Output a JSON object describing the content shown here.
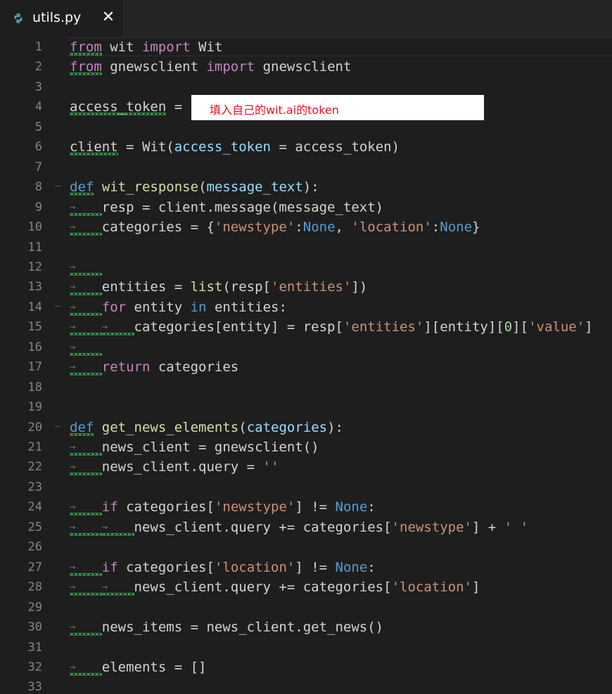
{
  "tab": {
    "label": "utils.py",
    "icon": "python-file-icon",
    "close": "✕"
  },
  "overlay": {
    "text": "填入自己的wit.ai的token"
  },
  "lines": [
    {
      "n": "1",
      "tokens": [
        [
          "k",
          "from"
        ],
        [
          "",
          ""
        ],
        [
          "",
          " wit "
        ],
        [
          "k",
          "import"
        ],
        [
          "",
          " Wit"
        ]
      ]
    },
    {
      "n": "2",
      "tokens": [
        [
          "k",
          "from"
        ],
        [
          "",
          " gnewsclient "
        ],
        [
          "k",
          "import"
        ],
        [
          "",
          " gnewsclient"
        ]
      ]
    },
    {
      "n": "3",
      "tokens": []
    },
    {
      "n": "4",
      "tokens": [
        [
          "",
          "access_token = "
        ]
      ]
    },
    {
      "n": "5",
      "tokens": []
    },
    {
      "n": "6",
      "tokens": [
        [
          "",
          "client = Wit("
        ],
        [
          "p",
          "access_token"
        ],
        [
          "",
          " = access_token)"
        ]
      ]
    },
    {
      "n": "7",
      "tokens": []
    },
    {
      "n": "8",
      "tokens": [
        [
          "d",
          "def"
        ],
        [
          "",
          " "
        ],
        [
          "f",
          "wit_response"
        ],
        [
          "",
          "("
        ],
        [
          "p",
          "message_text"
        ],
        [
          "",
          "):"
        ]
      ]
    },
    {
      "n": "9",
      "tokens": [
        [
          "",
          "    resp = client.message(message_text)"
        ]
      ]
    },
    {
      "n": "10",
      "tokens": [
        [
          "",
          "    categories = {"
        ],
        [
          "s",
          "'newstype'"
        ],
        [
          "",
          ":"
        ],
        [
          "c",
          "None"
        ],
        [
          "",
          ", "
        ],
        [
          "s",
          "'location'"
        ],
        [
          "",
          ":"
        ],
        [
          "c",
          "None"
        ],
        [
          "",
          "}"
        ]
      ]
    },
    {
      "n": "11",
      "tokens": []
    },
    {
      "n": "12",
      "tokens": []
    },
    {
      "n": "13",
      "tokens": [
        [
          "",
          "    entities = "
        ],
        [
          "bi",
          "list"
        ],
        [
          "",
          "(resp["
        ],
        [
          "s",
          "'entities'"
        ],
        [
          "",
          "])"
        ]
      ]
    },
    {
      "n": "14",
      "tokens": [
        [
          "",
          "    "
        ],
        [
          "k",
          "for"
        ],
        [
          "",
          " entity "
        ],
        [
          "c",
          "in"
        ],
        [
          "",
          " entities:"
        ]
      ]
    },
    {
      "n": "15",
      "tokens": [
        [
          "",
          "        categories[entity] = resp["
        ],
        [
          "s",
          "'entities'"
        ],
        [
          "",
          "][entity]["
        ],
        [
          "n",
          "0"
        ],
        [
          "",
          "]["
        ],
        [
          "s",
          "'value'"
        ],
        [
          "",
          "]"
        ]
      ]
    },
    {
      "n": "16",
      "tokens": []
    },
    {
      "n": "17",
      "tokens": [
        [
          "",
          "    "
        ],
        [
          "k",
          "return"
        ],
        [
          "",
          " categories"
        ]
      ]
    },
    {
      "n": "18",
      "tokens": []
    },
    {
      "n": "19",
      "tokens": []
    },
    {
      "n": "20",
      "tokens": [
        [
          "d",
          "def"
        ],
        [
          "",
          " "
        ],
        [
          "f",
          "get_news_elements"
        ],
        [
          "",
          "("
        ],
        [
          "p",
          "categories"
        ],
        [
          "",
          "):"
        ]
      ]
    },
    {
      "n": "21",
      "tokens": [
        [
          "",
          "    news_client = gnewsclient()"
        ]
      ]
    },
    {
      "n": "22",
      "tokens": [
        [
          "",
          "    news_client.query = "
        ],
        [
          "s",
          "''"
        ]
      ]
    },
    {
      "n": "23",
      "tokens": []
    },
    {
      "n": "24",
      "tokens": [
        [
          "",
          "    "
        ],
        [
          "k",
          "if"
        ],
        [
          "",
          " categories["
        ],
        [
          "s",
          "'newstype'"
        ],
        [
          "",
          "] != "
        ],
        [
          "c",
          "None"
        ],
        [
          "",
          ":"
        ]
      ]
    },
    {
      "n": "25",
      "tokens": [
        [
          "",
          "        news_client.query += categories["
        ],
        [
          "s",
          "'newstype'"
        ],
        [
          "",
          "] + "
        ],
        [
          "s",
          "' '"
        ]
      ]
    },
    {
      "n": "26",
      "tokens": []
    },
    {
      "n": "27",
      "tokens": [
        [
          "",
          "    "
        ],
        [
          "k",
          "if"
        ],
        [
          "",
          " categories["
        ],
        [
          "s",
          "'location'"
        ],
        [
          "",
          "] != "
        ],
        [
          "c",
          "None"
        ],
        [
          "",
          ":"
        ]
      ]
    },
    {
      "n": "28",
      "tokens": [
        [
          "",
          "        news_client.query += categories["
        ],
        [
          "s",
          "'location'"
        ],
        [
          "",
          "]"
        ]
      ]
    },
    {
      "n": "29",
      "tokens": []
    },
    {
      "n": "30",
      "tokens": [
        [
          "",
          "    news_items = news_client.get_news()"
        ]
      ]
    },
    {
      "n": "31",
      "tokens": []
    },
    {
      "n": "32",
      "tokens": [
        [
          "",
          "    elements = []"
        ]
      ]
    },
    {
      "n": "33",
      "tokens": []
    }
  ]
}
